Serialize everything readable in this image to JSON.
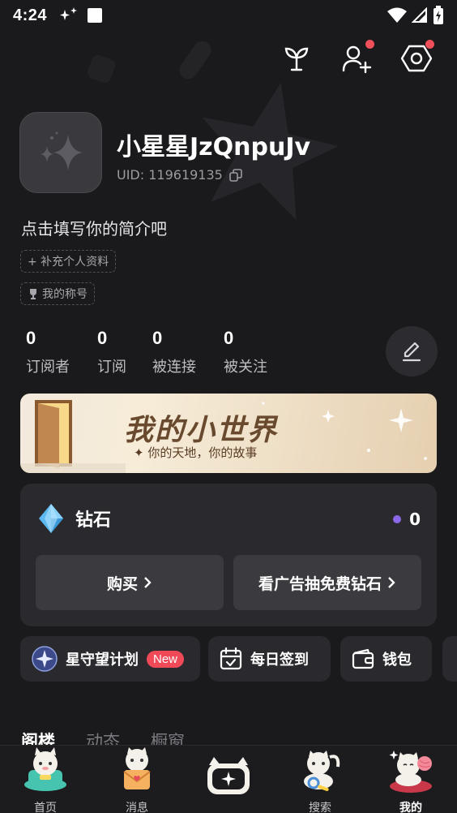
{
  "status_bar": {
    "time": "4:24"
  },
  "profile": {
    "username": "小星星JzQnpuJv",
    "uid": "UID: 119619135",
    "bio": "点击填写你的简介吧",
    "tag_profile": "+ 补充个人资料",
    "tag_title": "我的称号"
  },
  "stats": [
    {
      "value": "0",
      "label": "订阅者"
    },
    {
      "value": "0",
      "label": "订阅"
    },
    {
      "value": "0",
      "label": "被连接"
    },
    {
      "value": "0",
      "label": "被关注"
    }
  ],
  "banner": {
    "title": "我的小世界",
    "subtitle": "✦ 你的天地，你的故事"
  },
  "diamond": {
    "label": "钻石",
    "count": "0",
    "buy_label": "购买",
    "ad_label": "看广告抽免费钻石"
  },
  "shortcuts": {
    "star_plan": "星守望计划",
    "new_badge": "New",
    "sign_in": "每日签到",
    "wallet": "钱包"
  },
  "tabs": [
    "阁楼",
    "动态",
    "橱窗"
  ],
  "nav": {
    "home": "首页",
    "messages": "消息",
    "search": "搜索",
    "mine": "我的"
  },
  "colors": {
    "background": "#1a1a1c",
    "card": "#2a2a2e",
    "accent_red": "#f04a58",
    "diamond_purple": "#8a68e8"
  },
  "icons": [
    "sprout-icon",
    "add-friend-icon",
    "settings-icon",
    "copy-icon",
    "trophy-icon",
    "edit-icon",
    "diamond-icon",
    "star-badge-icon",
    "calendar-check-icon",
    "wallet-icon"
  ]
}
